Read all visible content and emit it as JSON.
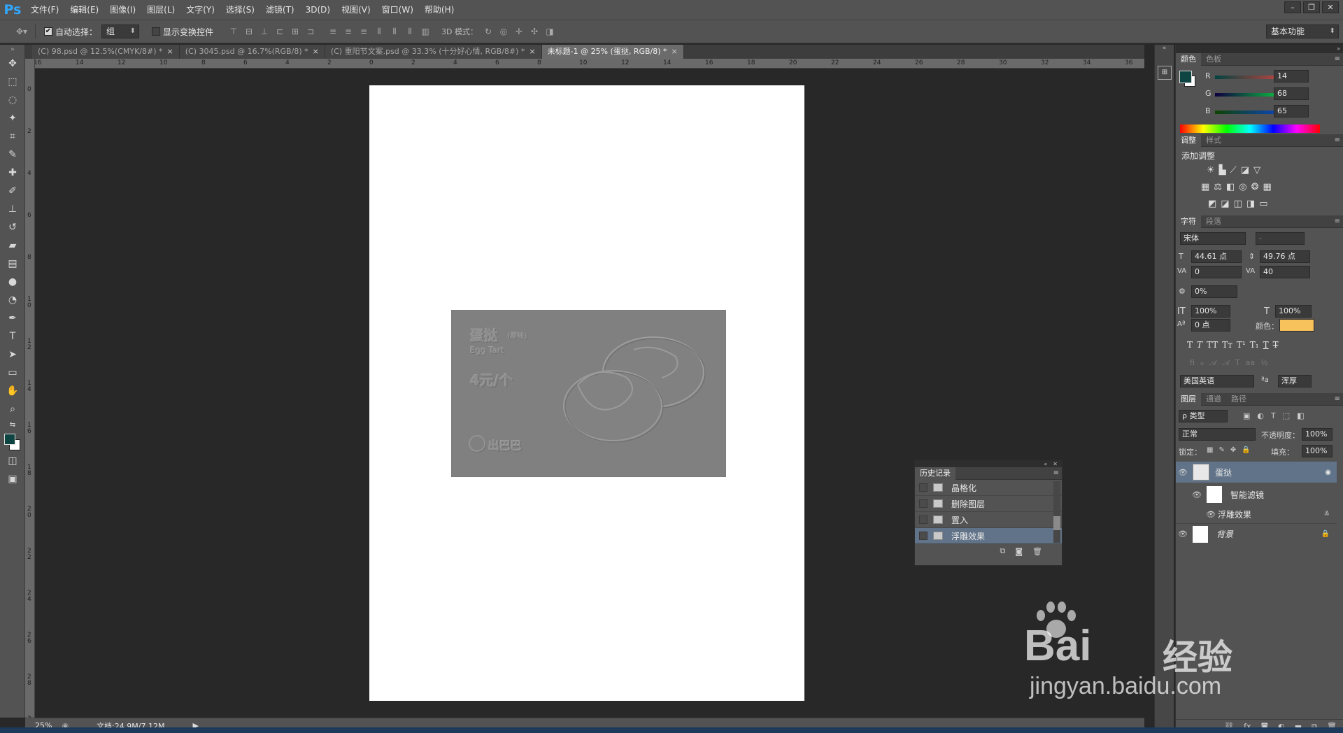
{
  "app": {
    "logo": "Ps",
    "menu": [
      "文件(F)",
      "编辑(E)",
      "图像(I)",
      "图层(L)",
      "文字(Y)",
      "选择(S)",
      "滤镜(T)",
      "3D(D)",
      "视图(V)",
      "窗口(W)",
      "帮助(H)"
    ],
    "window_controls": [
      "–",
      "❐",
      "✕"
    ]
  },
  "options_bar": {
    "auto_select_label": "自动选择：",
    "auto_select_checked": "✔",
    "auto_select_value": "组",
    "show_transform_label": "显示变换控件",
    "mode_3d_label": "3D 模式：",
    "workspace": "基本功能"
  },
  "tabs": [
    {
      "label": "(C) 98.psd @ 12.5%(CMYK/8#) *",
      "close": "×"
    },
    {
      "label": "(C) 3045.psd @ 16.7%(RGB/8) *",
      "close": "×"
    },
    {
      "label": "(C) 重阳节文案.psd @ 33.3% (十分好心情, RGB/8#) *",
      "close": "×"
    },
    {
      "label": "未标题-1 @ 25% (蛋挞, RGB/8) *",
      "close": "×"
    }
  ],
  "ruler": {
    "h": [
      "16",
      "14",
      "12",
      "10",
      "8",
      "6",
      "4",
      "2",
      "0",
      "2",
      "4",
      "6",
      "8",
      "10",
      "12",
      "14",
      "16",
      "18",
      "20",
      "22",
      "24",
      "26",
      "28",
      "30",
      "32",
      "34",
      "36"
    ],
    "v": [
      "0",
      "2",
      "4",
      "6",
      "8",
      "1 0",
      "1 2",
      "1 4",
      "1 6",
      "1 8",
      "2 0",
      "2 2",
      "2 4",
      "2 6",
      "2 8",
      "3"
    ]
  },
  "canvas": {
    "title": "蛋挞",
    "subtitle_tag": "(原味)",
    "subtitle_en": "Egg Tart",
    "price": "4元/个",
    "logo_text": "出巴巴"
  },
  "status": {
    "zoom": "25%",
    "doc": "文档:24.9M/7.12M"
  },
  "color_panel": {
    "tabs": [
      "颜色",
      "色板"
    ],
    "r_label": "R",
    "r_value": "14",
    "g_label": "G",
    "g_value": "68",
    "b_label": "B",
    "b_value": "65",
    "foreground": "#0e4441"
  },
  "adjust_panel": {
    "tabs": [
      "调整",
      "样式"
    ],
    "title": "添加调整"
  },
  "char_panel": {
    "tabs": [
      "字符",
      "段落"
    ],
    "font": "宋体",
    "style": "-",
    "size": "44.61 点",
    "leading": "49.76 点",
    "kerning": "0",
    "tracking": "40",
    "scale_pct": "0%",
    "v_scale": "100%",
    "h_scale": "100%",
    "baseline": "0 点",
    "color_label": "颜色：",
    "color": "#f7c15c",
    "language": "美国英语",
    "aa_label": "ªa",
    "aa": "浑厚"
  },
  "layers_panel": {
    "tabs": [
      "图层",
      "通道",
      "路径"
    ],
    "filter_kind": "ρ 类型",
    "blend": "正常",
    "opacity_label": "不透明度：",
    "opacity": "100%",
    "lock_label": "锁定：",
    "fill_label": "填充：",
    "fill": "100%",
    "layers": [
      {
        "name": "蛋挞"
      },
      {
        "name": "智能滤镜"
      },
      {
        "name": "浮雕效果"
      },
      {
        "name": "背景"
      }
    ]
  },
  "history_panel": {
    "title": "历史记录",
    "items": [
      "晶格化",
      "删除图层",
      "置入",
      "浮雕效果"
    ]
  },
  "watermark": {
    "brand": "Bai",
    "cn": "经验",
    "url": "jingyan.baidu.com"
  }
}
